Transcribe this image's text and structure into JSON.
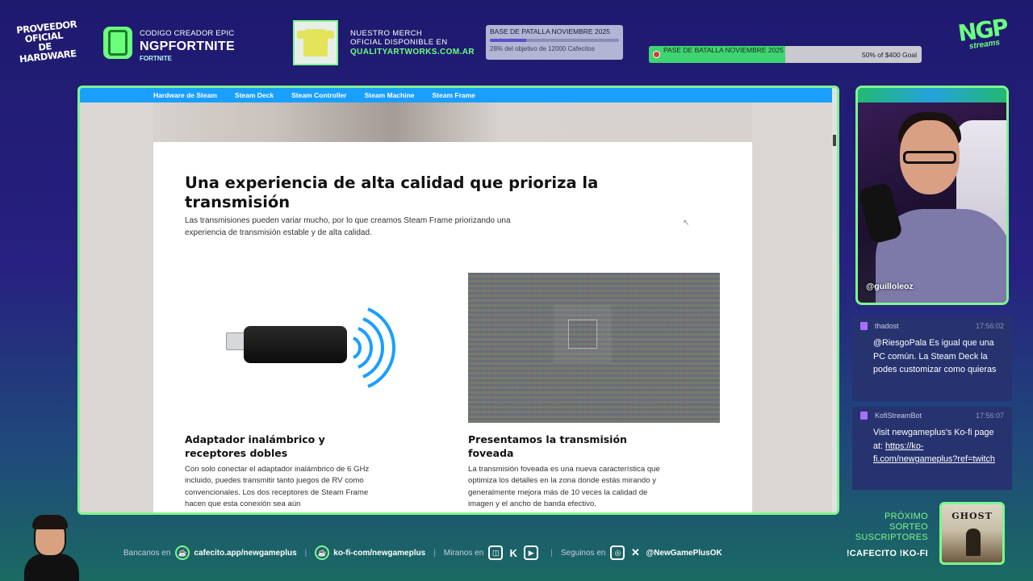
{
  "overlay": {
    "sponsor_logo": [
      "PROVEEDOR",
      "OFICIAL DE",
      "HARDWARE"
    ],
    "creator_code": {
      "line1": "CODIGO CREADOR EPIC",
      "code": "NGPFORTNITE",
      "game": "FORTNITE"
    },
    "merch": {
      "line1": "NUESTRO MERCH",
      "line2": "OFICIAL DISPONIBLE EN",
      "url": "QUALITYARTWORKS.COM.AR"
    },
    "goal_cafecito": {
      "title": "BASE DE PATALLA NOVIEMBRE 2025",
      "status": "28% del objetivo de 12000 Cafecitos",
      "progress_fraction": 0.28
    },
    "goal_kofi": {
      "title": "PASE DE BATALLA NOVIEMBRE 2025",
      "status": "50% of $400 Goal",
      "progress_fraction": 0.5
    },
    "brand_logo": {
      "mark": "NGP",
      "sub": "streams"
    }
  },
  "browser": {
    "nav": [
      "Hardware de Steam",
      "Steam Deck",
      "Steam Controller",
      "Steam Machine",
      "Steam Frame"
    ],
    "heading": "Una experiencia de alta calidad que prioriza la transmisión",
    "lead": "Las transmisiones pueden variar mucho, por lo que creamos Steam Frame priorizando una experiencia de transmisión estable y de alta calidad.",
    "features": [
      {
        "title": "Adaptador inalámbrico y receptores dobles",
        "text": "Con solo conectar el adaptador inalámbrico de 6 GHz incluido, puedes transmitir tanto juegos de RV como convencionales. Los dos receptores de Steam Frame hacen que esta conexión sea aún"
      },
      {
        "title": "Presentamos la transmisión foveada",
        "text": "La transmisión foveada es una nueva característica que optimiza los detalles en la zona donde estás mirando y generalmente mejora más de 10 veces la calidad de imagen y el ancho de banda efectivo."
      }
    ]
  },
  "webcam": {
    "handle": "@guilloleoz"
  },
  "chat": [
    {
      "user": "thadost",
      "time": "17:56:02",
      "message": "@RiesgoPala Es igual que una PC común. La Steam Deck la podes customizar como quieras"
    },
    {
      "user": "KofiStreamBot",
      "time": "17:56:07",
      "message_prefix": "Visit newgameplus's Ko-fi page at: ",
      "link": "https://ko-fi.com/newgameplus?ref=twitch"
    }
  ],
  "footer": {
    "bancanos_label": "Bancanos en",
    "cafecito": "cafecito.app/newgameplus",
    "kofi": "ko-fi-com/newgameplus",
    "miranos_label": "Miranos en",
    "seguinos_label": "Seguinos en",
    "social_handle": "@NewGamePlusOK",
    "separator": "|"
  },
  "promo": {
    "line1": "PRÓXIMO",
    "line2": "SORTEO",
    "line3": "SUSCRIPTORES",
    "commands": "!CAFECITO  !KO-FI",
    "game_title": "GHOST"
  },
  "colors": {
    "accent_green": "#7ff78e",
    "steam_blue": "#1a9fff",
    "twitch_purple": "#a970ff",
    "chat_bg": "#26336f"
  }
}
